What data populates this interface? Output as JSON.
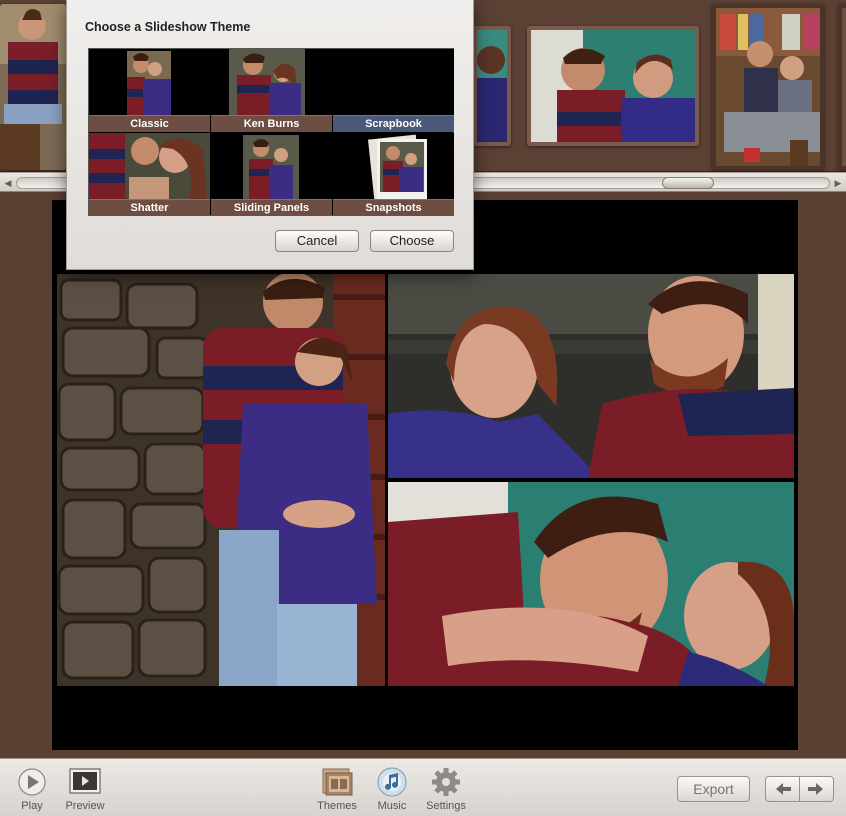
{
  "dialog": {
    "title": "Choose a Slideshow Theme",
    "themes": [
      {
        "label": "Classic",
        "selected": false
      },
      {
        "label": "Ken Burns",
        "selected": false
      },
      {
        "label": "Scrapbook",
        "selected": true
      },
      {
        "label": "Shatter",
        "selected": false
      },
      {
        "label": "Sliding Panels",
        "selected": false
      },
      {
        "label": "Snapshots",
        "selected": false
      }
    ],
    "cancel_label": "Cancel",
    "choose_label": "Choose"
  },
  "toolbar": {
    "play_label": "Play",
    "preview_label": "Preview",
    "themes_label": "Themes",
    "music_label": "Music",
    "settings_label": "Settings",
    "export_label": "Export"
  },
  "icons": {
    "play": "play-icon",
    "preview": "preview-icon",
    "themes": "themes-icon",
    "music": "music-icon",
    "settings": "gear-icon",
    "prev": "arrow-left-icon",
    "next": "arrow-right-icon"
  },
  "colors": {
    "background": "#5a3f33",
    "caption": "#6e4e42",
    "selected_caption": "#4a5879"
  }
}
